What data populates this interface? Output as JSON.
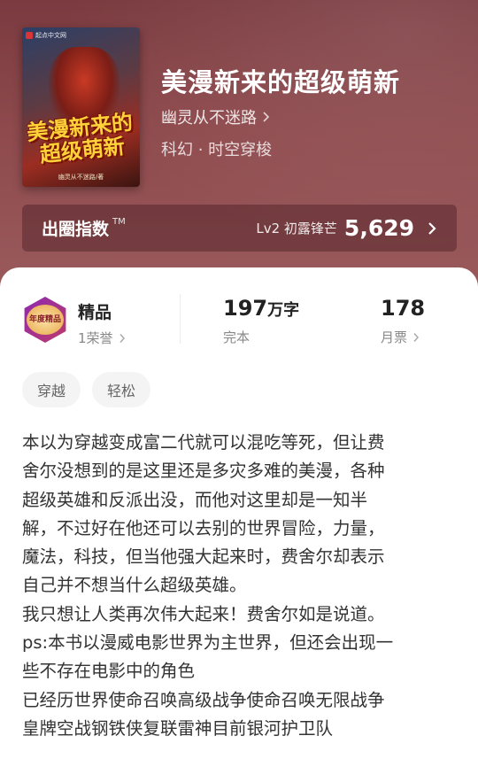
{
  "colors": {
    "hero_bg": "#8e4a4d",
    "card_bg": "#ffffff",
    "tag_bg": "#f4f4f4",
    "badge_accent": "#8b2bb0"
  },
  "cover": {
    "publisher": "起点中文网",
    "art_title_line1": "美漫新来的",
    "art_title_line2": "超级萌新",
    "art_author": "幽灵从不迷路/著"
  },
  "book": {
    "title": "美漫新来的超级萌新",
    "author": "幽灵从不迷路",
    "genre": "科幻 · 时空穿梭"
  },
  "index": {
    "title": "出圈指数",
    "tm": "TM",
    "level": "Lv2 初露锋芒",
    "value": "5,629"
  },
  "stats": {
    "quality_label": "精品",
    "quality_sub": "1荣誉",
    "badge_text": "年度精品",
    "words_num": "197",
    "words_unit": "万字",
    "words_sub": "完本",
    "tickets_num": "178",
    "tickets_sub": "月票"
  },
  "tags": [
    "穿越",
    "轻松"
  ],
  "synopsis": [
    "本以为穿越变成富二代就可以混吃等死，但让费",
    "舍尔没想到的是这里还是多灾多难的美漫，各种",
    "超级英雄和反派出没，而他对这里却是一知半",
    "解，不过好在他还可以去别的世界冒险，力量，",
    "魔法，科技，但当他强大起来时，费舍尔却表示",
    "自己并不想当什么超级英雄。",
    "我只想让人类再次伟大起来！费舍尔如是说道。",
    "ps:本书以漫威电影世界为主世界，但还会出现一",
    "些不存在电影中的角色",
    "已经历世界使命召唤高级战争使命召唤无限战争",
    "皇牌空战钢铁侠复联雷神目前银河护卫队"
  ]
}
